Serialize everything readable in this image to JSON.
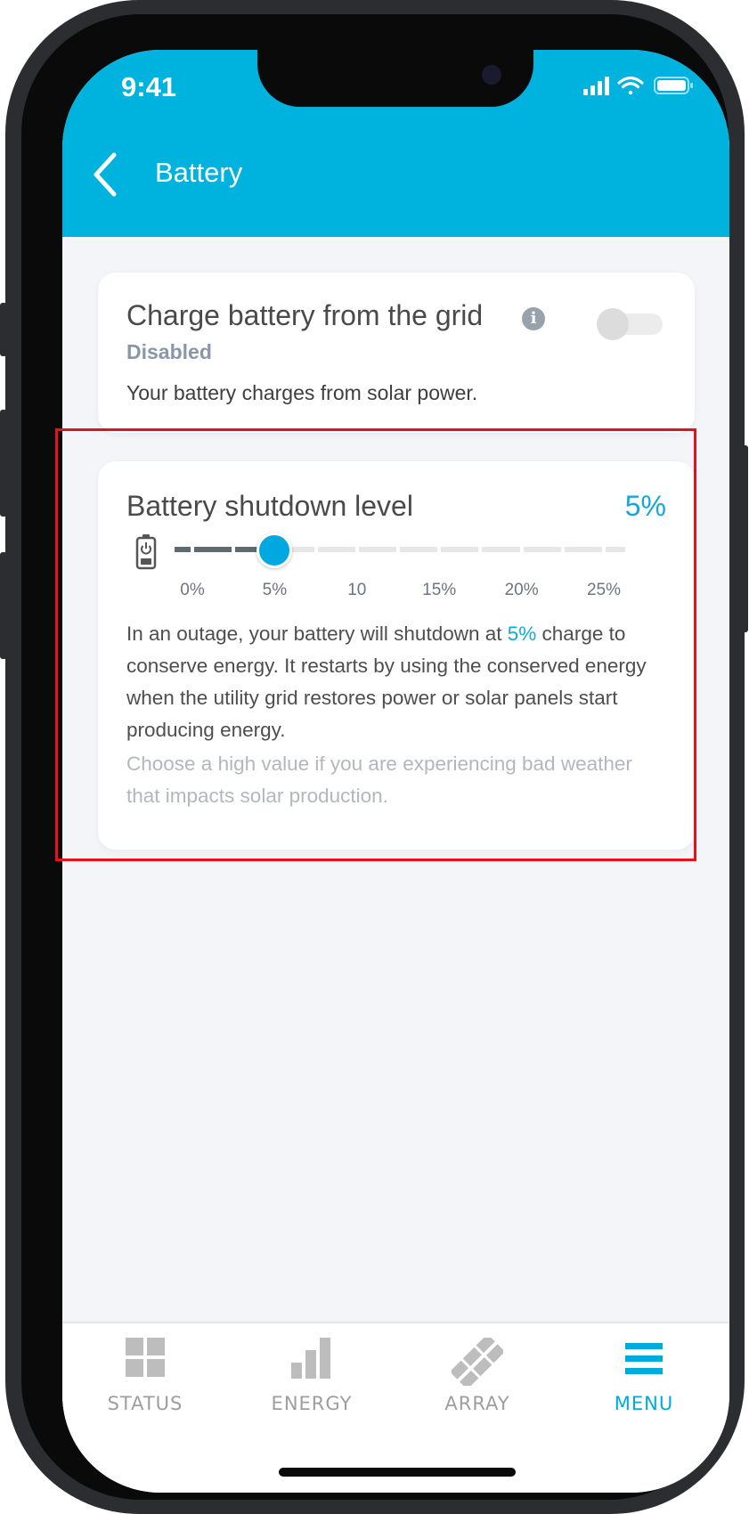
{
  "status_bar": {
    "time": "9:41"
  },
  "header": {
    "title": "Battery"
  },
  "grid_charge_card": {
    "title": "Charge battery from the grid",
    "status": "Disabled",
    "description": "Your battery charges from solar power.",
    "toggle_on": false
  },
  "shutdown_card": {
    "title": "Battery shutdown level",
    "value": "5%",
    "slider": {
      "value_percent": 5,
      "min": 0,
      "max": 25,
      "tick_labels": [
        "0%",
        "5%",
        "10",
        "15%",
        "20%",
        "25%"
      ]
    },
    "desc_before": "In an outage, your battery will shutdown at ",
    "desc_value": "5%",
    "desc_after": " charge to conserve energy. It restarts by using the conserved energy when the utility grid restores power or solar panels start producing energy.",
    "hint": "Choose a high value if you are experiencing bad weather that impacts solar production."
  },
  "tabbar": {
    "tabs": [
      {
        "label": "STATUS",
        "icon": "grid-icon",
        "active": false
      },
      {
        "label": "ENERGY",
        "icon": "bar-chart-icon",
        "active": false
      },
      {
        "label": "ARRAY",
        "icon": "solar-array-icon",
        "active": false
      },
      {
        "label": "MENU",
        "icon": "hamburger-menu-icon",
        "active": true
      }
    ]
  },
  "colors": {
    "accent": "#00b2de",
    "highlight_box": "#e8101b",
    "inactive_tab": "#9e9e9e"
  }
}
